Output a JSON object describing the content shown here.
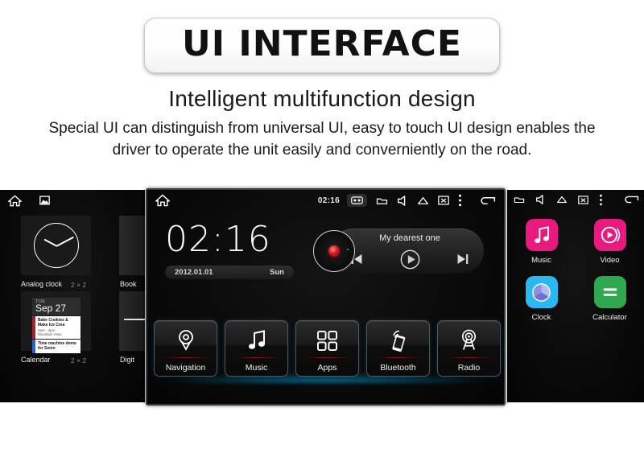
{
  "header": {
    "title": "UI INTERFACE",
    "subtitle": "Intelligent multifunction design",
    "desc_line1": "Special UI can distinguish from universal UI, easy to touch UI design enables the",
    "desc_line2": "driver to operate the unit easily and converniently on the road."
  },
  "left_screen": {
    "statusbar": {
      "home_icon": "home-icon",
      "wallpaper_icon": "image-icon"
    },
    "widgets": [
      {
        "label": "Analog clock",
        "size": "2 × 2"
      },
      {
        "label": "Calendar",
        "size": "2 × 2"
      },
      {
        "label": "Book",
        "size": ""
      },
      {
        "label": "Digit",
        "size": ""
      }
    ],
    "calendar_widget": {
      "day": "TUE",
      "date": "Sep 27",
      "events": [
        {
          "title": "Bake Cookies & Make Ice Crea",
          "time": "2pm - 3pm",
          "place": "Mountain View"
        },
        {
          "title": "Time machine demo for Senio",
          "time": "",
          "place": ""
        }
      ]
    }
  },
  "center_screen": {
    "statusbar": {
      "home_icon": "home-icon",
      "time": "02:16",
      "icons": [
        "cassette-icon",
        "folder-icon",
        "volume-icon",
        "eject-icon",
        "screen-off-icon",
        "more-vert-icon",
        "back-icon"
      ]
    },
    "clock": {
      "time": "02:16",
      "date": "2012.01.01",
      "weekday": "Sun"
    },
    "media": {
      "track_title": "My dearest one",
      "prev_icon": "skip-previous-icon",
      "play_icon": "play-icon",
      "next_icon": "skip-next-icon",
      "disc_icon": "vinyl-record-icon"
    },
    "tiles": [
      {
        "label": "Navigation",
        "icon": "location-pin-icon"
      },
      {
        "label": "Music",
        "icon": "music-note-icon"
      },
      {
        "label": "Apps",
        "icon": "grid-apps-icon"
      },
      {
        "label": "Bluetooth",
        "icon": "phone-link-icon"
      },
      {
        "label": "Radio",
        "icon": "radio-tower-icon"
      }
    ]
  },
  "right_screen": {
    "statusbar": {
      "icons": [
        "folder-icon",
        "volume-icon",
        "eject-icon",
        "screen-off-icon",
        "more-vert-icon",
        "back-icon"
      ]
    },
    "apps": [
      {
        "label": "Music",
        "icon": "music-note-icon",
        "color": "#E8197F"
      },
      {
        "label": "Video",
        "icon": "video-play-icon",
        "color": "#E8197F"
      },
      {
        "label": "Clock",
        "icon": "clock-sphere-icon",
        "color": "#2BB8F0"
      },
      {
        "label": "Calculator",
        "icon": "equals-icon",
        "color": "#2FA84F"
      }
    ]
  },
  "colors": {
    "accent_pink": "#E8197F",
    "accent_blue": "#2BB8F0",
    "accent_green": "#2FA84F",
    "tile_glow": "#00BEFF",
    "tile_rule": "#8C1414"
  }
}
